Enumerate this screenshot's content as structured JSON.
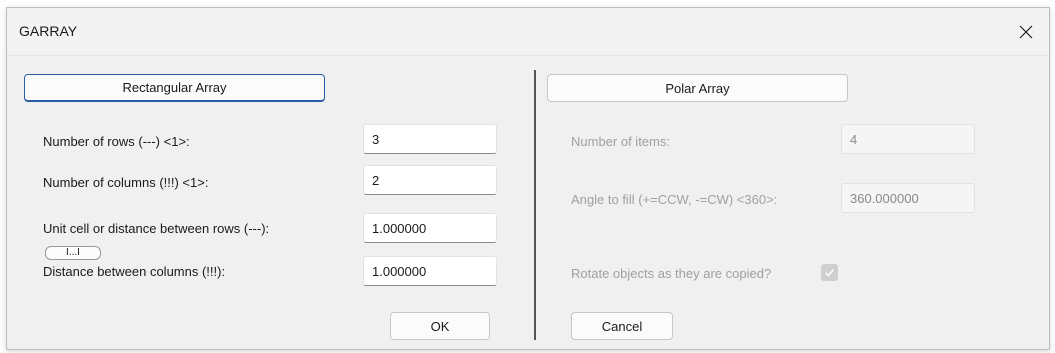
{
  "dialog": {
    "title": "GARRAY",
    "close_glyph": "✕"
  },
  "rectangular": {
    "tab_label": "Rectangular Array",
    "rows_label": "Number of rows (---) <1>:",
    "rows_value": "3",
    "columns_label": "Number of columns (!!!) <1>:",
    "columns_value": "2",
    "row_distance_label": "Unit cell or distance between rows (---):",
    "row_distance_value": "1.000000",
    "pick_button_label": "I...I",
    "column_distance_label": "Distance between columns (!!!):",
    "column_distance_value": "1.000000"
  },
  "polar": {
    "tab_label": "Polar Array",
    "items_label": "Number of items:",
    "items_value": "4",
    "angle_label": "Angle to fill (+=CCW, -=CW) <360>:",
    "angle_value": "360.000000",
    "rotate_label": "Rotate objects as they are copied?",
    "rotate_checked": true
  },
  "buttons": {
    "ok": "OK",
    "cancel": "Cancel"
  },
  "colors": {
    "accent": "#2a5ea8",
    "disabled_text": "#a0a0a0"
  }
}
